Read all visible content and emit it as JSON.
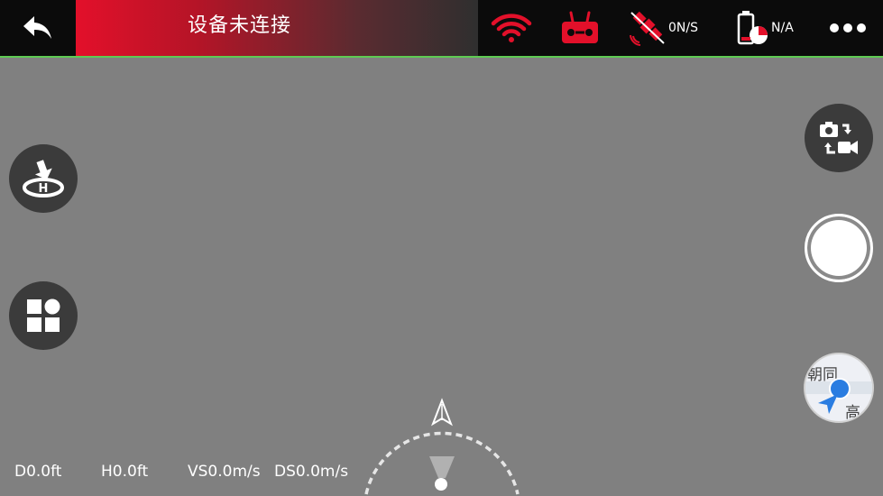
{
  "header": {
    "connection_status": "设备未连接",
    "satellite_text": "0N/S",
    "battery_text": "N/A"
  },
  "icons": {
    "back": "back-arrow-icon",
    "wifi": "wifi-icon",
    "remote": "remote-controller-icon",
    "satellite": "satellite-icon",
    "battery": "battery-icon",
    "more": "more-dots-icon",
    "home": "return-home-icon",
    "grid": "modes-grid-icon",
    "camera_switch": "camera-video-switch-icon"
  },
  "colors": {
    "accent_red": "#e3102a",
    "status_line": "#5ecb52",
    "background": "#808080"
  },
  "map": {
    "label_1": "朝同",
    "label_2": "高丽"
  },
  "telemetry": {
    "distance": "D0.0ft",
    "height": "H0.0ft",
    "vertical_speed": "VS0.0m/s",
    "distance_speed": "DS0.0m/s"
  }
}
